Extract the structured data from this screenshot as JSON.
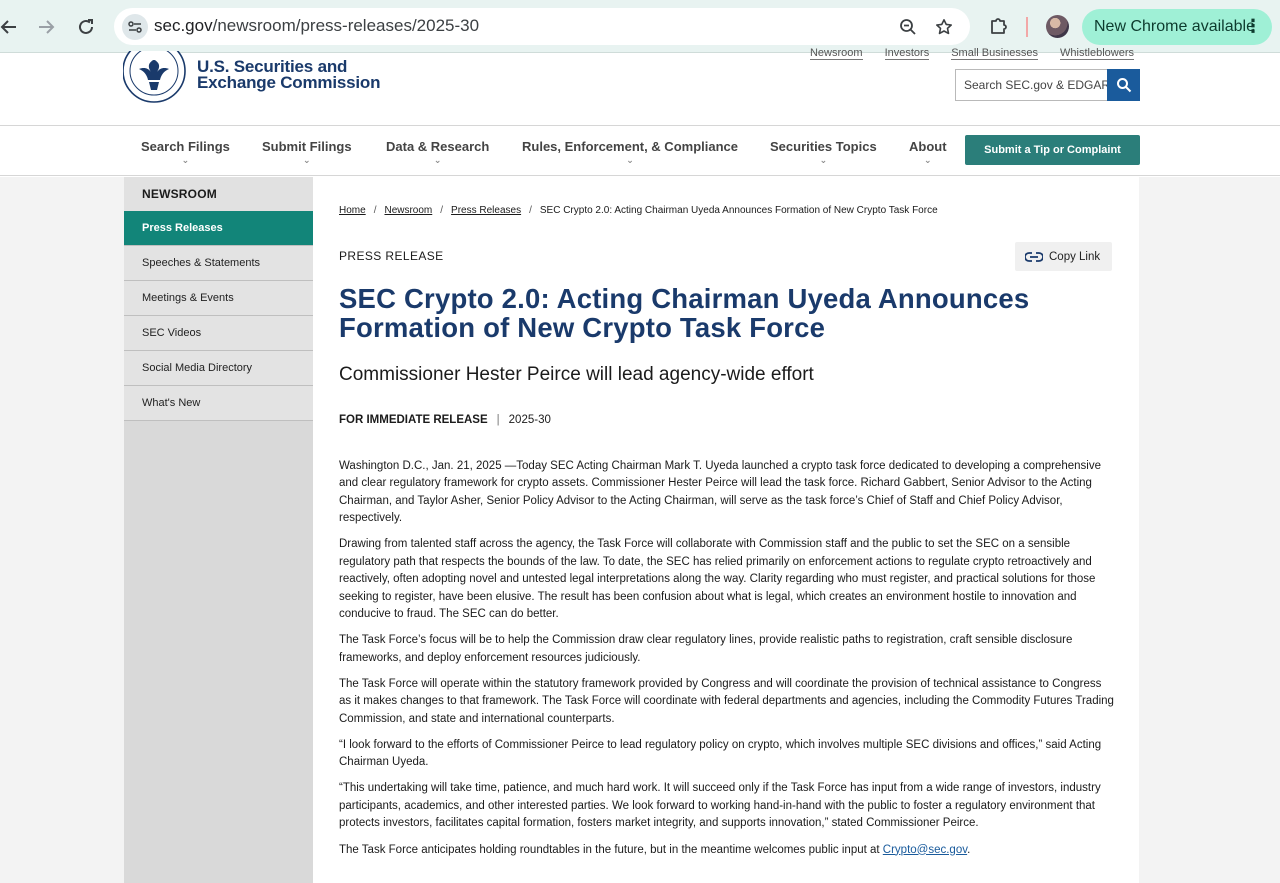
{
  "browser": {
    "url_host": "sec.gov",
    "url_path": "/newsroom/press-releases/2025-30",
    "update_label": "New Chrome available"
  },
  "header": {
    "brand_line1": "U.S. Securities and",
    "brand_line2": "Exchange Commission",
    "utility_links": [
      "Newsroom",
      "Investors",
      "Small Businesses",
      "Whistleblowers"
    ],
    "search_placeholder": "Search SEC.gov & EDGAR"
  },
  "nav": {
    "items": [
      "Search Filings",
      "Submit Filings",
      "Data & Research",
      "Rules, Enforcement, & Compliance",
      "Securities Topics",
      "About"
    ],
    "tip_button": "Submit a Tip or Complaint"
  },
  "sidebar": {
    "title": "NEWSROOM",
    "items": [
      "Press Releases",
      "Speeches & Statements",
      "Meetings & Events",
      "SEC Videos",
      "Social Media Directory",
      "What's New"
    ],
    "active_index": 0
  },
  "breadcrumb": {
    "items": [
      "Home",
      "Newsroom",
      "Press Releases"
    ],
    "current": "SEC Crypto 2.0: Acting Chairman Uyeda Announces Formation of New Crypto Task Force"
  },
  "article": {
    "kicker": "PRESS RELEASE",
    "copy_link": "Copy Link",
    "title": "SEC Crypto 2.0: Acting Chairman Uyeda Announces Formation of New Crypto Task Force",
    "subtitle": "Commissioner Hester Peirce will lead agency-wide effort",
    "release_label": "FOR IMMEDIATE RELEASE",
    "release_number": "2025-30",
    "paragraphs": [
      "Washington D.C., Jan. 21, 2025 —Today SEC Acting Chairman Mark T. Uyeda launched a crypto task force dedicated to developing a comprehensive and clear regulatory framework for crypto assets. Commissioner Hester Peirce will lead the task force. Richard Gabbert, Senior Advisor to the Acting Chairman, and Taylor Asher, Senior Policy Advisor to the Acting Chairman, will serve as the task force’s Chief of Staff and Chief Policy Advisor, respectively.",
      "Drawing from talented staff across the agency, the Task Force will collaborate with Commission staff and the public to set the SEC on a sensible regulatory path that respects the bounds of the law. To date, the SEC has relied primarily on enforcement actions to regulate crypto retroactively and reactively, often adopting novel and untested legal interpretations along the way. Clarity regarding who must register, and practical solutions for those seeking to register, have been elusive. The result has been confusion about what is legal, which creates an environment hostile to innovation and conducive to fraud. The SEC can do better.",
      "The Task Force’s focus will be to help the Commission draw clear regulatory lines, provide realistic paths to registration, craft sensible disclosure frameworks, and deploy enforcement resources judiciously.",
      "The Task Force will operate within the statutory framework provided by Congress and will coordinate the provision of technical assistance to Congress as it makes changes to that framework. The Task Force will coordinate with federal departments and agencies, including the Commodity Futures Trading Commission, and state and international counterparts.",
      "“I look forward to the efforts of Commissioner Peirce to lead regulatory policy on crypto, which involves multiple SEC divisions and offices,” said Acting Chairman Uyeda.",
      "“This undertaking will take time, patience, and much hard work. It will succeed only if the Task Force has input from a wide range of investors, industry participants, academics, and other interested parties. We look forward to working hand-in-hand with the public to foster a regulatory environment that protects investors, facilitates capital formation, fosters market integrity, and supports innovation,” stated Commissioner Peirce."
    ],
    "last_paragraph_text": "The Task Force anticipates holding roundtables in the future, but in the meantime welcomes public input at ",
    "contact_email": "Crypto@sec.gov",
    "last_paragraph_end": "."
  }
}
